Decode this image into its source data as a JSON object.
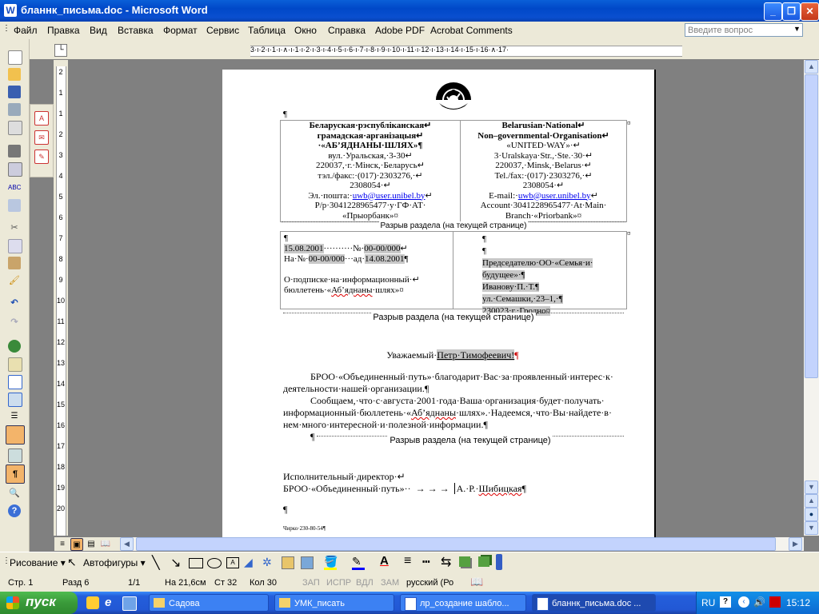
{
  "window": {
    "title": "бланнк_письма.doc - Microsoft Word",
    "app_icon": "W"
  },
  "menu": {
    "items": [
      "Файл",
      "Правка",
      "Вид",
      "Вставка",
      "Формат",
      "Сервис",
      "Таблица",
      "Окно",
      "Справка",
      "Adobe PDF",
      "Acrobat Comments"
    ],
    "help_placeholder": "Введите вопрос"
  },
  "ruler": {
    "h_ticks": "3·ı·2·ı·1·ı·∧·ı·1·ı·2·ı·3·ı·4·ı·5·ı·6·ı·7·ı·8·ı·9·ı·10·ı·11·ı·12·ı·13·ı·14·ı·15·ı·16·∧·17·",
    "v_numbers": [
      "2",
      "1",
      "1",
      "2",
      "3",
      "4",
      "5",
      "6",
      "7",
      "8",
      "9",
      "10",
      "11",
      "12",
      "13",
      "14",
      "15",
      "16",
      "17",
      "18",
      "19",
      "20"
    ]
  },
  "letterhead": {
    "pilcrow": "¶",
    "left": {
      "l1": "Беларуская·рэспубліканская↵",
      "l2": "грамадская·арганізацыя↵",
      "l3": "·«АБ’ЯДНАНЫ·ШЛЯХ»¶",
      "l4": "вул.·Уральская,·3-30↵",
      "l5": "220037,·г.·Мінск,·Беларусь↵",
      "l6": "тэл./факс:·(017)·2303276,·↵",
      "l7": "2308054·↵",
      "l8_label": "Эл.·пошта:·",
      "l8_link": "uwb@user.unibel.by",
      "l8_end": "↵",
      "l9": "Р/р·3041228965477·у·ГФ·АТ·",
      "l10": "«Прыорбанк»¤"
    },
    "right": {
      "l1": "Belarusian·National↵",
      "l2": "Non–governmental·Organisation↵",
      "l3": "«UNITED·WAY»·↵",
      "l4": "3·Uralskaya·Str.,·Ste.·30·↵",
      "l5": "220037,·Minsk,·Belarus·↵",
      "l6": "Tel./fax:·(017)·2303276,·↵",
      "l7": "2308054·↵",
      "l8_label": "E-mail:·",
      "l8_link": "uwb@user.unibel.by",
      "l8_end": "↵",
      "l9": "Account·3041228965477·At·Main·",
      "l10": "Branch·«Priorbank»¤"
    },
    "end_marks": "¤"
  },
  "section_break": "Разрыв раздела (на текущей странице)",
  "address_block": {
    "left": {
      "p": "¶",
      "date_line_a": "15.08.2001",
      "date_line_mid": "··········№·",
      "date_line_b": "00-00/000",
      "date_line_end": "↵",
      "ref_a": "На·№·",
      "ref_b": "00-00/000",
      "ref_mid": "···ад·",
      "ref_c": "14.08.2001",
      "ref_end": "¶",
      "subject1": "О·подписке·на·информационный·↵",
      "subject2a": "бюллетень·«",
      "subject2b": "Аб’яднаны",
      "subject2c": "·шлях»¤"
    },
    "right": {
      "p1": "¶",
      "p2": "¶",
      "r1": "Председателю·ОО·«Семья·и·",
      "r2": "будущее»·¶",
      "r3": "Иванову·П.·Т.¶",
      "r4": "ул.·Семашки,·23–1,·¶",
      "r5": "230023·г.·Гродно¤"
    }
  },
  "greeting": {
    "a": "Уважаемый·",
    "b": "Петр·Тимофеевич!",
    "c": "¶"
  },
  "body": {
    "p1a": "БРОО·«Объединенный·путь»·благодарит·Вас·за·проявленный·интерес·к·",
    "p1b": "деятельности·нашей·организации.¶",
    "p2a": "Сообщаем,·что·с·августа·2001·года·Ваша·организация·будет·получать·",
    "p2b_a": "информационный·бюллетень·«",
    "p2b_b": "Аб’яднаны",
    "p2b_c": "·шлях».·Надеемся,·что·Вы·найдете·в·",
    "p2c": "нем·много·интересной·и·полезной·информации.¶",
    "p3": "¶"
  },
  "signature": {
    "l1": "Исполнительный·директор·↵",
    "l2a": "БРОО·«Объединенный·путь»··",
    "arrows": "→      →      →",
    "l2b": "А.·Р.·",
    "l2c": "Шибицкая",
    "l2d": "¶",
    "p": "¶",
    "footer": "Чирко·230-80-54¶"
  },
  "draw_toolbar": {
    "drawing": "Рисование ▾",
    "autoshapes": "Автофигуры ▾"
  },
  "status": {
    "page": "Стр. 1",
    "section": "Разд  6",
    "pages": "1/1",
    "at": "На 21,6см",
    "line": "Ст  32",
    "col": "Кол  30",
    "rec": "ЗАП",
    "trk": "ИСПР",
    "ext": "ВДЛ",
    "ovr": "ЗАМ",
    "lang": "русский (Ро"
  },
  "taskbar": {
    "start": "пуск",
    "tasks": [
      "Садова",
      "УМК_писать",
      "лр_создание шабло...",
      "бланнк_письма.doc ..."
    ],
    "lang": "RU",
    "clock": "15:12"
  },
  "colors": {
    "titlebar": "#0a5fd8",
    "taskbar": "#245edb",
    "start": "#3a9a3a",
    "link": "#0000ee",
    "highlight": "#c8c8c8"
  }
}
